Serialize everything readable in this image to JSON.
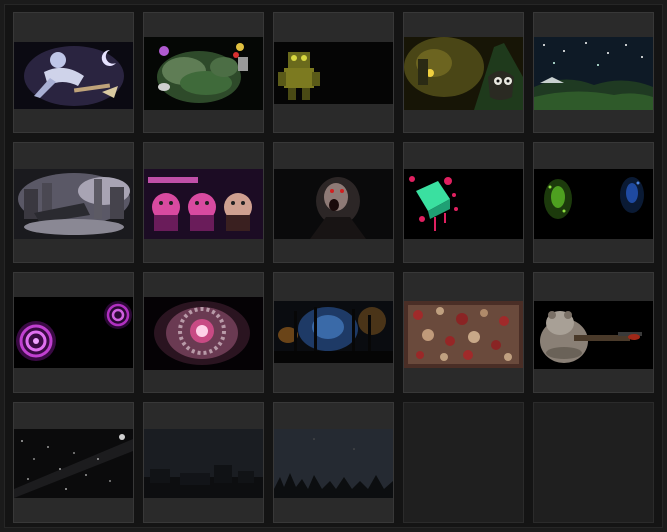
{
  "gallery": {
    "tiles": [
      {
        "title": "",
        "icon": "witch-on-broom-under-moon"
      },
      {
        "title": "",
        "icon": "misty-green-forest"
      },
      {
        "title": "",
        "icon": "yellow-robot-figure"
      },
      {
        "title": "",
        "icon": "lantern-cave-creature"
      },
      {
        "title": "",
        "icon": "night-sky-green-hills"
      },
      {
        "title": "",
        "icon": "foggy-gothic-town"
      },
      {
        "title": "",
        "icon": "three-bearded-faces-pink"
      },
      {
        "title": "",
        "icon": "vampire-face-dark"
      },
      {
        "title": "",
        "icon": "green-cube-pink-splatter"
      },
      {
        "title": "",
        "icon": "green-blue-particle-glow"
      },
      {
        "title": "",
        "icon": "purple-spirals"
      },
      {
        "title": "",
        "icon": "pink-orb-ring"
      },
      {
        "title": "",
        "icon": "blue-haunted-forest"
      },
      {
        "title": "",
        "icon": "red-leaf-texture"
      },
      {
        "title": "",
        "icon": "bear-with-shotgun"
      },
      {
        "title": "",
        "icon": "grey-starfield-streak"
      },
      {
        "title": "",
        "icon": "dark-night-buildings"
      },
      {
        "title": "",
        "icon": "dark-forest-silhouette"
      },
      {
        "title": "",
        "icon": "empty-slot"
      },
      {
        "title": "",
        "icon": "empty-slot"
      }
    ]
  }
}
